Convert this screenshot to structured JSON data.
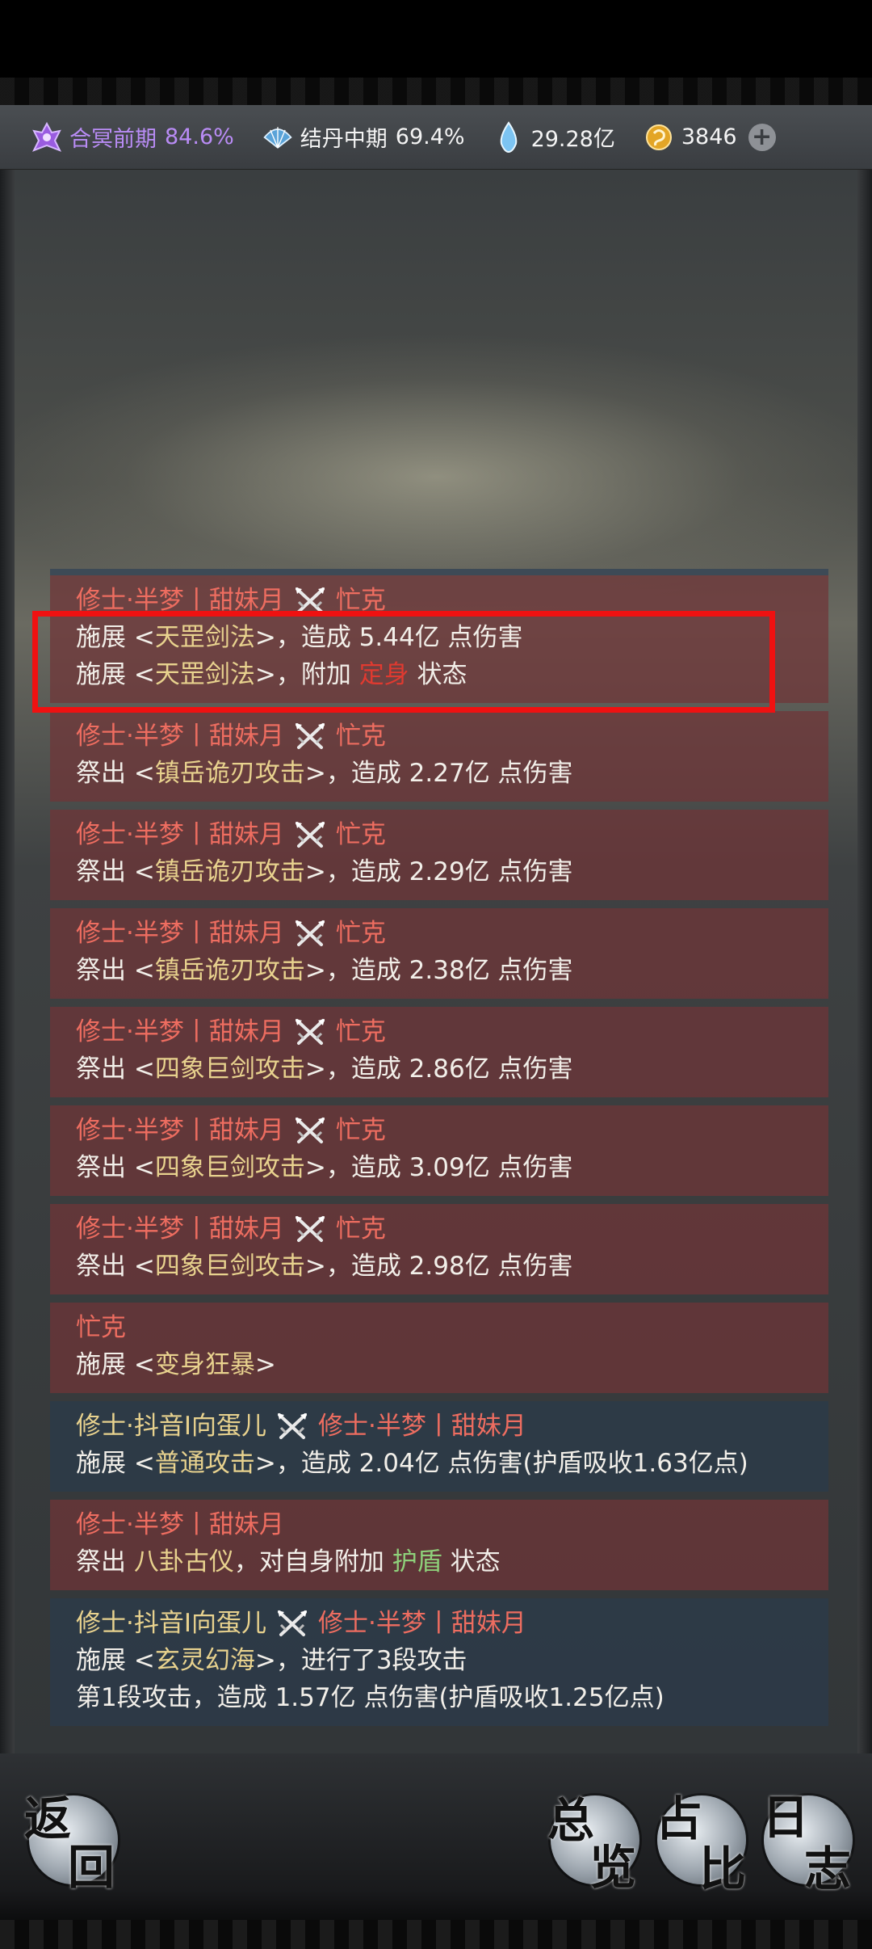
{
  "resources": [
    {
      "icon": "cultivation-realm-icon",
      "name": "合冥前期",
      "value": "84.6%"
    },
    {
      "icon": "fan-icon",
      "name": "结丹中期",
      "value": "69.4%"
    },
    {
      "icon": "spirit-stone-icon",
      "name": "",
      "value": "29.28亿"
    },
    {
      "icon": "gold-coin-icon",
      "name": "",
      "value": "3846"
    }
  ],
  "plus_symbol": "+",
  "battle_log": [
    {
      "style": "red",
      "head": {
        "attacker": "修士·半梦丨甜妹月",
        "target": "忙克"
      },
      "lines": [
        [
          "施展 <",
          "天罡剑法",
          ">，造成 5.44亿 点伤害"
        ],
        [
          "施展 <",
          "天罡剑法",
          ">，附加 ",
          "定身",
          " 状态"
        ]
      ]
    },
    {
      "style": "red",
      "head": {
        "attacker": "修士·半梦丨甜妹月",
        "target": "忙克"
      },
      "lines": [
        [
          "祭出 <",
          "镇岳诡刃攻击",
          ">，造成 2.27亿 点伤害"
        ]
      ]
    },
    {
      "style": "red",
      "head": {
        "attacker": "修士·半梦丨甜妹月",
        "target": "忙克"
      },
      "lines": [
        [
          "祭出 <",
          "镇岳诡刃攻击",
          ">，造成 2.29亿 点伤害"
        ]
      ]
    },
    {
      "style": "red",
      "head": {
        "attacker": "修士·半梦丨甜妹月",
        "target": "忙克"
      },
      "lines": [
        [
          "祭出 <",
          "镇岳诡刃攻击",
          ">，造成 2.38亿 点伤害"
        ]
      ]
    },
    {
      "style": "red",
      "head": {
        "attacker": "修士·半梦丨甜妹月",
        "target": "忙克"
      },
      "lines": [
        [
          "祭出 <",
          "四象巨剑攻击",
          ">，造成 2.86亿 点伤害"
        ]
      ]
    },
    {
      "style": "red",
      "head": {
        "attacker": "修士·半梦丨甜妹月",
        "target": "忙克"
      },
      "lines": [
        [
          "祭出 <",
          "四象巨剑攻击",
          ">，造成 3.09亿 点伤害"
        ]
      ]
    },
    {
      "style": "red",
      "head": {
        "attacker": "修士·半梦丨甜妹月",
        "target": "忙克"
      },
      "lines": [
        [
          "祭出 <",
          "四象巨剑攻击",
          ">，造成 2.98亿 点伤害"
        ]
      ]
    },
    {
      "style": "red",
      "head": {
        "attacker": "忙克",
        "target": ""
      },
      "lines": [
        [
          "施展 <",
          "变身狂暴",
          ">"
        ]
      ]
    },
    {
      "style": "blue",
      "head": {
        "attacker": "修士·抖音I向蛋儿",
        "target": "修士·半梦丨甜妹月"
      },
      "lines": [
        [
          "施展 <",
          "普通攻击",
          ">，造成 2.04亿 点伤害(护盾吸收1.63亿点)"
        ]
      ]
    },
    {
      "style": "red",
      "head": {
        "attacker": "修士·半梦丨甜妹月",
        "target": ""
      },
      "lines": [
        [
          "祭出 ",
          "八卦古仪",
          "，对自身附加 ",
          "护盾",
          " 状态"
        ]
      ]
    },
    {
      "style": "blue",
      "head": {
        "attacker": "修士·抖音I向蛋儿",
        "target": "修士·半梦丨甜妹月"
      },
      "lines": [
        [
          "施展 <",
          "玄灵幻海",
          ">，进行了3段攻击"
        ],
        [
          "第1段攻击，造成 1.57亿 点伤害(护盾吸收1.25亿点)"
        ]
      ]
    }
  ],
  "buttons": {
    "back": [
      "返",
      "回"
    ],
    "overview": [
      "总",
      "览"
    ],
    "ratio": [
      "占",
      "比"
    ],
    "log": [
      "日",
      "志"
    ]
  },
  "colors": {
    "attacker_red": "#ee6d60",
    "attacker_gold": "#e8d28e",
    "skill": "#e8d28e",
    "status_bad": "#e03a30",
    "status_good": "#8ed07a",
    "highlight_box": "#ef1111"
  }
}
